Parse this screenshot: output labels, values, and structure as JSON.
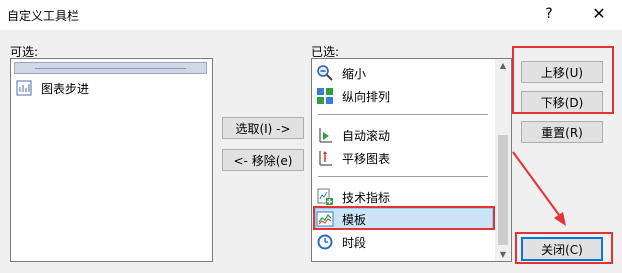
{
  "dialog": {
    "title": "自定义工具栏",
    "help": "?",
    "close_glyph": "✕"
  },
  "left_panel": {
    "label": "可选:",
    "items": [
      {
        "label": "图表步进",
        "icon": "chart-step-icon"
      }
    ]
  },
  "middle_buttons": {
    "add": "选取(I) ->",
    "remove": "<- 移除(e)"
  },
  "right_panel": {
    "label": "已选:",
    "items": [
      {
        "label": "缩小",
        "icon": "zoom-out-icon"
      },
      {
        "label": "纵向排列",
        "icon": "tile-vertical-icon"
      },
      {
        "label": "自动滚动",
        "icon": "auto-scroll-icon"
      },
      {
        "label": "平移图表",
        "icon": "chart-shift-icon"
      },
      {
        "label": "技术指标",
        "icon": "indicators-icon"
      },
      {
        "label": "模板",
        "icon": "templates-icon"
      },
      {
        "label": "时段",
        "icon": "periods-icon"
      }
    ],
    "selected_index": 5
  },
  "side_buttons": {
    "move_up": "上移(U)",
    "move_down": "下移(D)",
    "reset": "重置(R)",
    "close": "关闭(C)"
  },
  "colors": {
    "annotation": "#e53333",
    "selection": "#cce4f7",
    "default_button_border": "#0078d7"
  }
}
